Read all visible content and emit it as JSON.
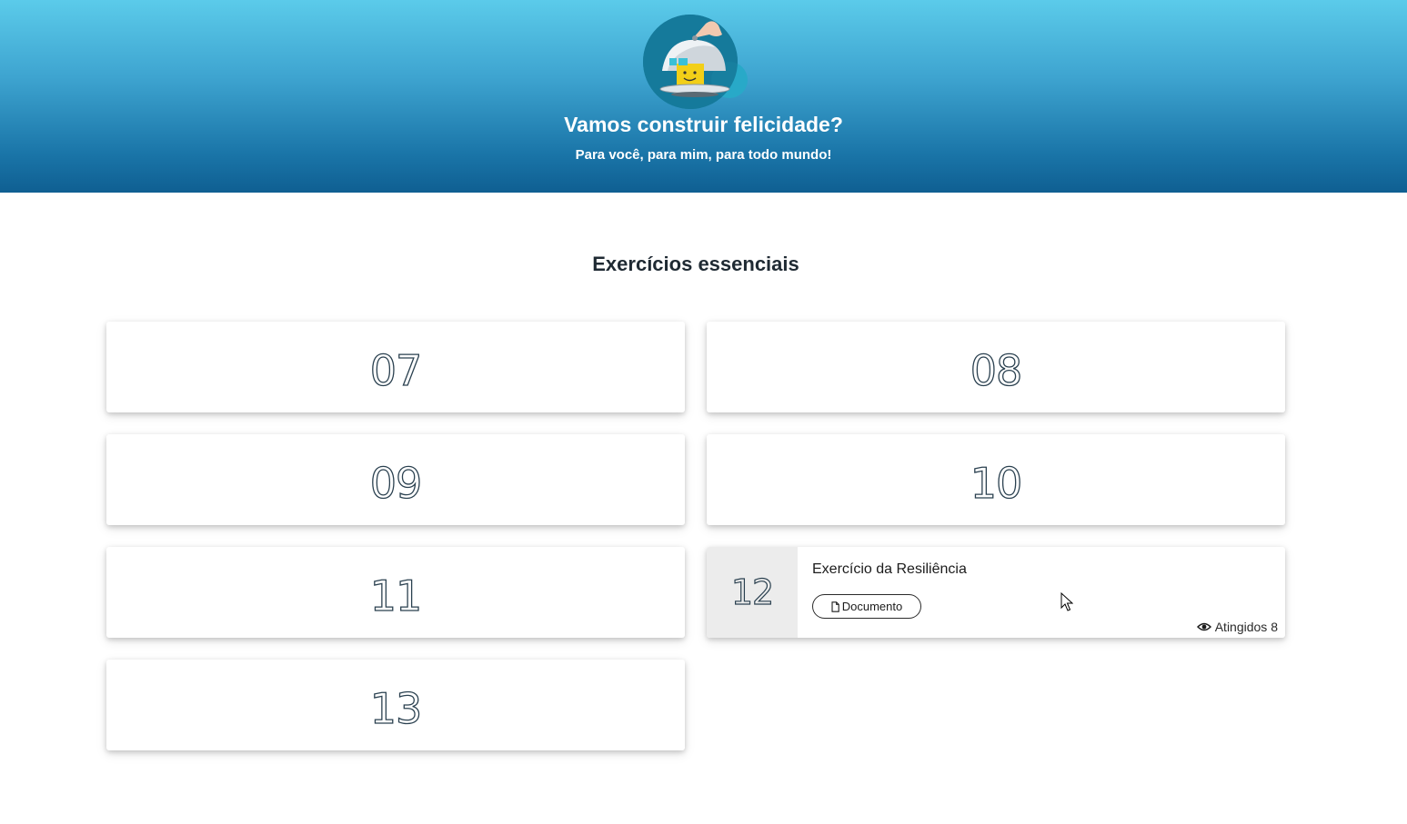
{
  "header": {
    "logo_icon": "cloche-serving-happy-box-icon",
    "title": "Vamos construir felicidade?",
    "subtitle": "Para você, para mim, para todo mundo!"
  },
  "section": {
    "title": "Exercícios essenciais"
  },
  "cards": [
    {
      "number": "07"
    },
    {
      "number": "08"
    },
    {
      "number": "09"
    },
    {
      "number": "10"
    },
    {
      "number": "11"
    },
    {
      "number": "12",
      "title": "Exercício da Resiliência",
      "type_label": "Documento",
      "type_icon": "file-icon",
      "reached_label": "Atingidos 8",
      "reached_icon": "eye-icon"
    },
    {
      "number": "13"
    }
  ],
  "colors": {
    "header_gradient_top": "#5bcbea",
    "header_gradient_bottom": "#0f5f92",
    "number_outline": "#2b4150"
  }
}
